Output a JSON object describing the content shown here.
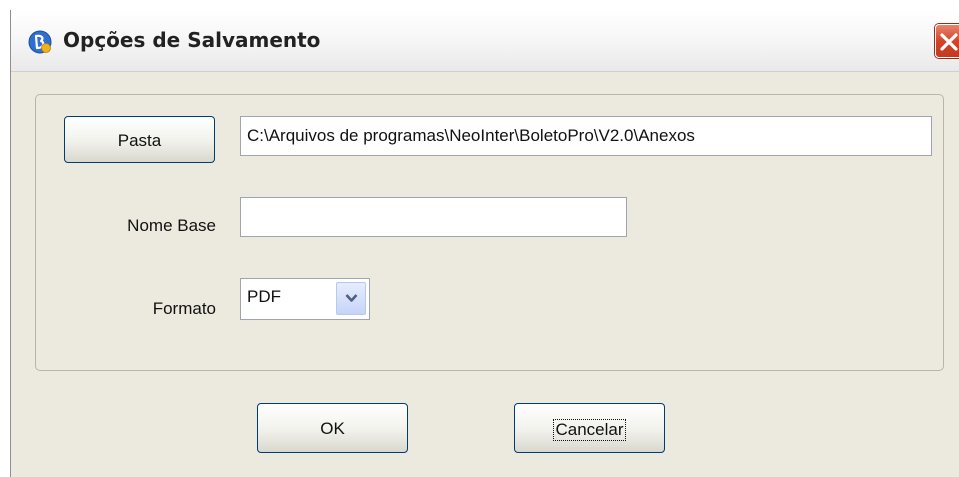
{
  "window": {
    "title": "Opções de Salvamento",
    "close_icon": "close-icon",
    "app_icon": "boleto-app-icon"
  },
  "form": {
    "pasta_button_label": "Pasta",
    "path_value": "C:\\Arquivos de programas\\NeoInter\\BoletoPro\\V2.0\\Anexos",
    "nome_base_label": "Nome Base",
    "nome_base_value": "",
    "formato_label": "Formato",
    "formato_selected": "PDF",
    "dropdown_icon": "chevron-down-icon"
  },
  "actions": {
    "ok_label": "OK",
    "cancel_label": "Cancelar"
  },
  "colors": {
    "dialog_bg": "#eceade",
    "button_border": "#003c74",
    "close_red": "#d2452a"
  }
}
